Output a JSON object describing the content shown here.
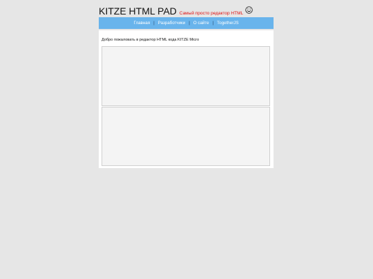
{
  "header": {
    "title": "KITZE HTML PAD",
    "tagline": "Самый просто редактор HTML",
    "emoji_icon": "smiley-face-icon"
  },
  "nav": {
    "items": [
      {
        "label": "Главная"
      },
      {
        "label": "Разработчики"
      },
      {
        "label": "О сайте"
      },
      {
        "label": "TogetherJS"
      }
    ],
    "separator": "|"
  },
  "main": {
    "welcome_text": "Добро пожаловать в редактор HTML кода KITZE Micro",
    "html_editor": {
      "value": ""
    },
    "preview": {
      "value": ""
    }
  },
  "colors": {
    "background": "#e6e6e6",
    "nav_bar": "#69b4ec",
    "tagline": "#d11111",
    "panel": "#ffffff",
    "editor_bg": "#f4f4f4"
  }
}
